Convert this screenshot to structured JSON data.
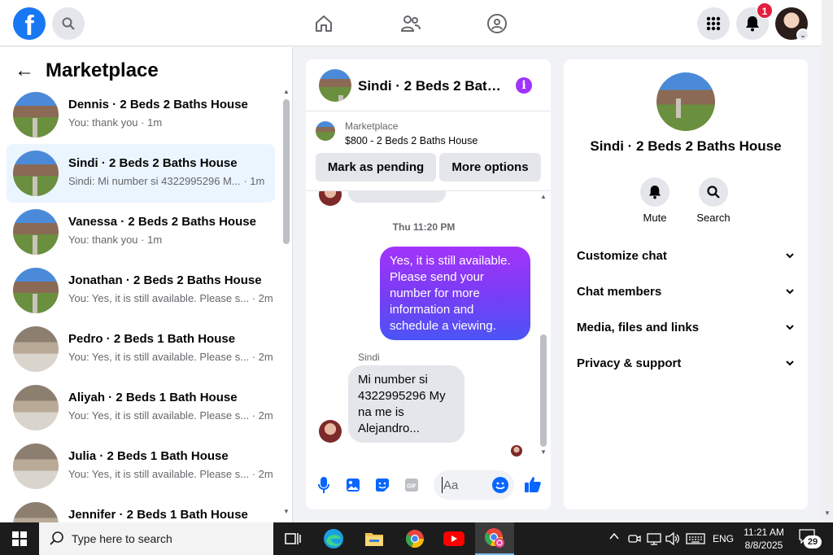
{
  "topnav": {
    "logo": "f",
    "notifications_badge": "1",
    "icons": [
      "facebook-logo",
      "search-icon",
      "home-icon",
      "friends-icon",
      "groups-icon",
      "apps-grid-icon",
      "bell-icon",
      "profile-avatar"
    ]
  },
  "marketplace": {
    "title": "Marketplace",
    "conversations": [
      {
        "title": "Dennis · 2 Beds 2 Baths House",
        "subtitle": "You: thank you · 1m",
        "thumb": "house"
      },
      {
        "title": "Sindi · 2 Beds 2 Baths House",
        "subtitle": "Sindi: Mi number si 4322995296 M... · 1m",
        "thumb": "house",
        "active": true
      },
      {
        "title": "Vanessa · 2 Beds 2 Baths House",
        "subtitle": "You: thank you · 1m",
        "thumb": "house"
      },
      {
        "title": "Jonathan · 2 Beds 2 Baths House",
        "subtitle": "You: Yes, it is still available. Please s... · 2m",
        "thumb": "house"
      },
      {
        "title": "Pedro · 2 Beds 1 Bath House",
        "subtitle": "You: Yes, it is still available. Please s... · 2m",
        "thumb": "room"
      },
      {
        "title": "Aliyah · 2 Beds 1 Bath House",
        "subtitle": "You: Yes, it is still available. Please s... · 2m",
        "thumb": "room"
      },
      {
        "title": "Julia · 2 Beds 1 Bath House",
        "subtitle": "You: Yes, it is still available. Please s... · 2m",
        "thumb": "room"
      },
      {
        "title": "Jennifer · 2 Beds 1 Bath House",
        "subtitle": "",
        "thumb": "room"
      }
    ]
  },
  "chat": {
    "header_title": "Sindi · 2 Beds 2 Bath...",
    "listing_label": "Marketplace",
    "listing_price": "$800 - 2 Beds 2 Baths House",
    "mark_pending_label": "Mark as pending",
    "more_options_label": "More options",
    "timestamp": "Thu 11:20 PM",
    "outgoing_message": "Yes, it is still available. Please send your number for more information and schedule a viewing.",
    "sender_name": "Sindi",
    "incoming_message": "Mi number si 4322995296 My na me is Alejandro...",
    "composer_placeholder": "Aa"
  },
  "details": {
    "title": "Sindi · 2 Beds 2 Baths House",
    "mute_label": "Mute",
    "search_label": "Search",
    "sections": [
      "Customize chat",
      "Chat members",
      "Media, files and links",
      "Privacy & support"
    ]
  },
  "taskbar": {
    "search_placeholder": "Type here to search",
    "language": "ENG",
    "time": "11:21 AM",
    "date": "8/8/2025",
    "notification_count": "29"
  },
  "colors": {
    "facebook_blue": "#1877f2",
    "bubble_gradient_top": "#a334fa",
    "bubble_gradient_bottom": "#4b54f5",
    "info_purple": "#a033ff",
    "badge_red": "#e41e3f"
  }
}
